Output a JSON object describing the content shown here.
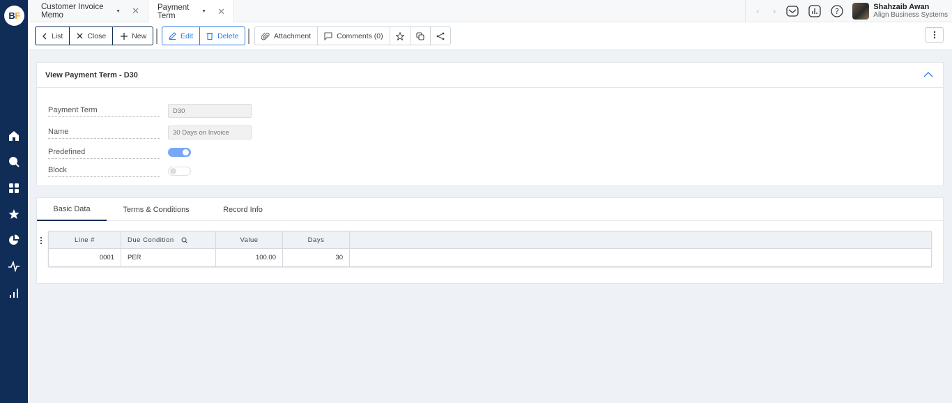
{
  "app": {
    "logo_b": "B",
    "logo_f": "F"
  },
  "sidebar": {
    "items": [
      {
        "icon": "home-icon"
      },
      {
        "icon": "search-icon"
      },
      {
        "icon": "apps-grid-icon"
      },
      {
        "icon": "star-icon"
      },
      {
        "icon": "pie-chart-icon"
      },
      {
        "icon": "activity-icon"
      },
      {
        "icon": "bar-chart-icon"
      }
    ]
  },
  "tabs": [
    {
      "label": "Customer Invoice Memo",
      "active": false
    },
    {
      "label": "Payment Term",
      "active": true
    }
  ],
  "user": {
    "name": "Shahzaib Awan",
    "company": "Align Business Systems"
  },
  "toolbar": {
    "list": "List",
    "close": "Close",
    "new": "New",
    "edit": "Edit",
    "delete": "Delete",
    "attachment": "Attachment",
    "comments": "Comments (0)"
  },
  "form": {
    "title": "View Payment Term - D30",
    "fields": {
      "payment_term_label": "Payment Term",
      "payment_term_value": "D30",
      "name_label": "Name",
      "name_value": "30 Days on Invoice",
      "predefined_label": "Predefined",
      "predefined_value": true,
      "block_label": "Block",
      "block_value": false
    }
  },
  "detail_tabs": [
    {
      "label": "Basic Data",
      "active": true
    },
    {
      "label": "Terms & Conditions",
      "active": false
    },
    {
      "label": "Record Info",
      "active": false
    }
  ],
  "grid": {
    "columns": [
      "Line #",
      "Due Condition",
      "Value",
      "Days"
    ],
    "rows": [
      {
        "line": "0001",
        "due_condition": "PER",
        "value": "100.00",
        "days": "30"
      }
    ]
  }
}
